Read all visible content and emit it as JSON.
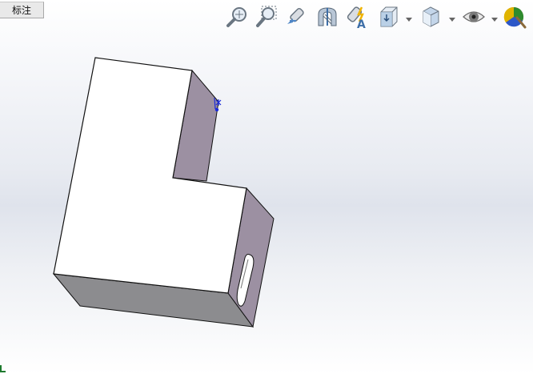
{
  "tabs": {
    "annotate_label": "标注"
  },
  "toolbar": {
    "icons": [
      "zoom-to-fit-icon",
      "zoom-to-area-icon",
      "previous-view-icon",
      "section-view-icon",
      "dynamic-annotation-view-icon",
      "view-orientation-icon",
      "display-style-icon",
      "hide-show-items-icon",
      "appearance-icon"
    ]
  },
  "colors": {
    "face_top": "#ffffff",
    "face_side": "#9d91a3",
    "face_bottom": "#8a8a8d",
    "edge": "#111111",
    "sketch_point": "#1a2ad8"
  }
}
